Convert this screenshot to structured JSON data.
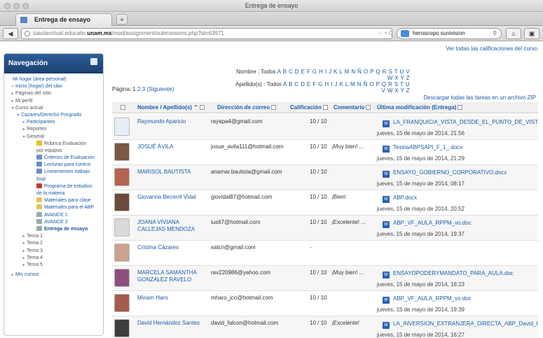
{
  "window": {
    "title": "Entrega de ensayo"
  },
  "tab": {
    "label": "Entrega de ensayo",
    "new_tab_glyph": "+"
  },
  "nav": {
    "url_prefix": "tuaulavirtual.educatic.",
    "url_domain": "unam.mx",
    "url_rest": "/mod/assignment/submissions.php?id=63971",
    "search_text": "heroscopo sunivision",
    "back_glyph": "◀",
    "home_glyph": "⌂"
  },
  "page": {
    "grades_link": "Ver todas las calificaciones del curso",
    "nombre_label": "Nombre : Todos",
    "nombre_letters": "A B C D E F G H I J K L M N Ñ O P Q R S T U V W X Y Z",
    "apellido_label": "Apellido(s) : Todos",
    "apellido_letters": "A B C D E F G H I J K L M N Ñ O P Q R S T U V W X Y Z",
    "pages_label": "Página:",
    "pages": [
      "1",
      "2",
      "3"
    ],
    "next_label": "(Siguiente)",
    "download_link": "Descargar todas las tareas en un archivo ZIP"
  },
  "sidebar": {
    "title": "Navegación",
    "items": [
      {
        "label": "Mi hogar (área personal)",
        "bullet": ""
      },
      {
        "label": "Inicio (hogar) del sitio",
        "bullet": "•"
      },
      {
        "label": "Páginas del sitio",
        "bullet": "▸"
      },
      {
        "label": "Mi perfil",
        "bullet": "▸"
      },
      {
        "label": "Curso actual",
        "bullet": "▾"
      },
      {
        "label": "Cazares/Derecho Posgrado",
        "bullet": "▾"
      },
      {
        "label": "Participantes",
        "bullet": "▸"
      },
      {
        "label": "Reportes",
        "bullet": "▸"
      },
      {
        "label": "General",
        "bullet": "▾"
      },
      {
        "label": "Rúbrica Evaluación",
        "bullet": ""
      },
      {
        "label": "por equipos",
        "bullet": ""
      },
      {
        "label": "Criterios de Evaluación",
        "bullet": ""
      },
      {
        "label": "Lecturas para control",
        "bullet": ""
      },
      {
        "label": "Lineamientos trabajo",
        "bullet": ""
      },
      {
        "label": "final",
        "bullet": ""
      },
      {
        "label": "Programa de estudios",
        "bullet": ""
      },
      {
        "label": "de la materia",
        "bullet": ""
      },
      {
        "label": "Materiales para clase",
        "bullet": ""
      },
      {
        "label": "Materiales para el ABP",
        "bullet": ""
      },
      {
        "label": "AVANCE 1",
        "bullet": ""
      },
      {
        "label": "AVANCE 2",
        "bullet": ""
      },
      {
        "label": "Entrega de ensayo",
        "bullet": ""
      },
      {
        "label": "Tema 1",
        "bullet": "▸"
      },
      {
        "label": "Tema 2",
        "bullet": "▸"
      },
      {
        "label": "Tema 3",
        "bullet": "▸"
      },
      {
        "label": "Tema 4",
        "bullet": "▸"
      },
      {
        "label": "Tema 5",
        "bullet": "▸"
      },
      {
        "label": "Mis cursos",
        "bullet": "▸"
      }
    ]
  },
  "table": {
    "headers": {
      "name": "Nombre / Apellido(s)",
      "email": "Dirección de correo",
      "grade": "Calificación",
      "comment": "Comentario",
      "modified": "Última modificación (Entrega)"
    },
    "rows": [
      {
        "name": "Raymundo Aparicio",
        "email": "rayapa4@gmail.com",
        "grade": "10 / 10",
        "comment": "",
        "file": "LA_FRANQUICIA_VISTA_DESDE_EL_PUNTO_DE_VIST",
        "date": "jueves, 15 de mayo de 2014, 21:56"
      },
      {
        "name": "JOSUÉ ÁVILA",
        "email": "josue_avila111@hotmail.com",
        "grade": "10 / 10",
        "comment": "¡Muy bien! ...",
        "file": "TesinaABPSAPI_F_1_.docx",
        "date": "jueves, 15 de mayo de 2014, 21:29"
      },
      {
        "name": "MARISOL BAUTISTA",
        "email": "anamar.bautista@gmail.com",
        "grade": "10 / 10",
        "comment": "",
        "file": "ENSAYO_GOBIERNO_CORPORATIVO.docx",
        "date": "jueves, 15 de mayo de 2014, 08:17"
      },
      {
        "name": "Giovanna Becerril Vidal",
        "email": "giovidal87@hotmail.com",
        "grade": "10 / 10",
        "comment": "¡Bien!",
        "file": "ABP.docx",
        "date": "jueves, 15 de mayo de 2014, 20:52"
      },
      {
        "name": "JOANA VIVIANA CALLEJAS MENDOZA",
        "email": "ius67@hotmail.com",
        "grade": "10 / 10",
        "comment": "¡Excelente! ...",
        "file": "ABP_VF_AULA_RPPM_vo.doc",
        "date": "jueves, 15 de mayo de 2014, 19:37"
      },
      {
        "name": "Cristina Cázares",
        "email": "xatcri@gmail.com",
        "grade": "-",
        "comment": "",
        "file": "",
        "date": ""
      },
      {
        "name": "MARCELA SAMANTHA GONZALEZ RAVELO",
        "email": "rav220986@yahoo.com",
        "grade": "10 / 10",
        "comment": "¡Muy bien! ...",
        "file": "ENSAYOPODERYMANDATO_PARA_AULA.doc",
        "date": "jueves, 15 de mayo de 2014, 16:23"
      },
      {
        "name": "Miriam Haro",
        "email": "mharo_jco@hotmail.com",
        "grade": "10 / 10",
        "comment": "",
        "file": "ABP_VF_AULA_RPPM_vo.doc",
        "date": "jueves, 15 de mayo de 2014, 19:39"
      },
      {
        "name": "David Hernández Santes",
        "email": "david_falcon@hotmail.com",
        "grade": "10 / 10",
        "comment": "¡Excelente!",
        "file": "LA_INVERSION_EXTRANJERA_DIRECTA_ABP_David_I",
        "date": "jueves, 15 de mayo de 2014, 16:27"
      }
    ]
  }
}
